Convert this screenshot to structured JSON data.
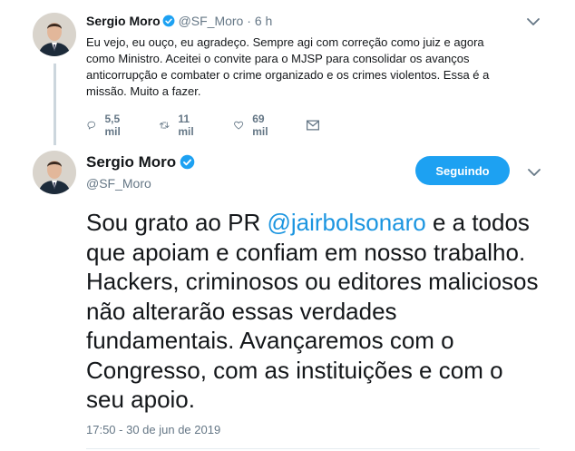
{
  "parent_tweet": {
    "name": "Sergio Moro",
    "handle": "@SF_Moro",
    "separator": "·",
    "time": "6 h",
    "text": "Eu vejo, eu ouço, eu agradeço. Sempre agi com correção como juiz e agora\ncomo Ministro. Aceitei o convite para o MJSP para consolidar os avanços\nanticorrupção e combater o crime organizado e os crimes violentos. Essa é a\nmissão. Muito a fazer.",
    "actions": {
      "replies": "5,5 mil",
      "retweets": "11 mil",
      "likes": "69 mil"
    }
  },
  "main_tweet": {
    "name": "Sergio Moro",
    "handle": "@SF_Moro",
    "follow_label": "Seguindo",
    "text_before": "Sou grato ao PR ",
    "mention": "@jairbolsonaro",
    "text_after": " e a todos que apoiam e confiam em nosso trabalho. Hackers, criminosos ou editores maliciosos não alterarão essas verdades fundamentais. Avançaremos com o Congresso, com as instituições e com o seu apoio.",
    "timestamp": "17:50 - 30 de jun de 2019"
  },
  "colors": {
    "accent": "#1da1f2",
    "link": "#1b95e0",
    "secondary_text": "#657786",
    "thread_line": "#ccd6dd"
  }
}
